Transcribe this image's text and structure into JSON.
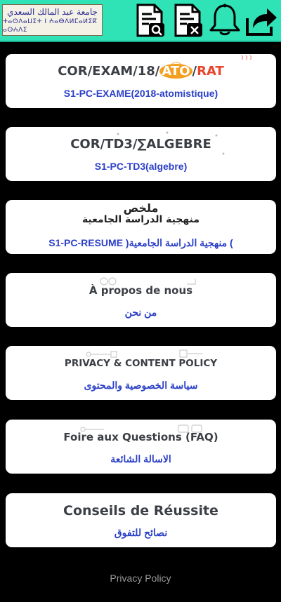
{
  "header": {
    "logo_arabic": "جامعة عبد المالك السعدي",
    "logo_tifinagh": "ⵜⴰⵙⴷⴰⵡⵉⵜ ⵏ ⵄⴰⴱⴷⵍⵎⴰⵍⵉⴽ ⴰⵙⵄⴷⵉ",
    "icons": [
      "document-search-icon",
      "document-close-icon",
      "bell-icon",
      "share-icon"
    ],
    "background": "#2fe3b6"
  },
  "cards": [
    {
      "title_parts": [
        "COR/EXAM/18/",
        "ATO",
        "/",
        "RAT"
      ],
      "subtitle": "S1-PC-EXAME(2018-atomistique)"
    },
    {
      "title_parts": [
        "COR/TD3/",
        "∑",
        "ALGEBRE"
      ],
      "subtitle": "S1-PC-TD3(algebre)"
    },
    {
      "title_line1": "ملخص",
      "title_line2": "منهجية",
      "title_line3": "الدراسة الجامعية",
      "subtitle": "S1-PC-RESUME )منهجية الدراسة الجامعية ("
    },
    {
      "title": "À propos de nous",
      "subtitle": "من نحن"
    },
    {
      "title": "PRIVACY & CONTENT POLICY",
      "subtitle": "سياسة الخصوصية والمحتوى"
    },
    {
      "title": "Foire aux Questions (FAQ)",
      "subtitle": "الاسالة الشائعة"
    },
    {
      "title": "Conseils de Réussite",
      "subtitle": "نصائح للتفوق"
    }
  ],
  "footer": {
    "link": "Privacy Policy"
  },
  "colors": {
    "subtitle": "#2c40c8",
    "card_bg": "#ffffff",
    "page_bg": "#000000"
  }
}
